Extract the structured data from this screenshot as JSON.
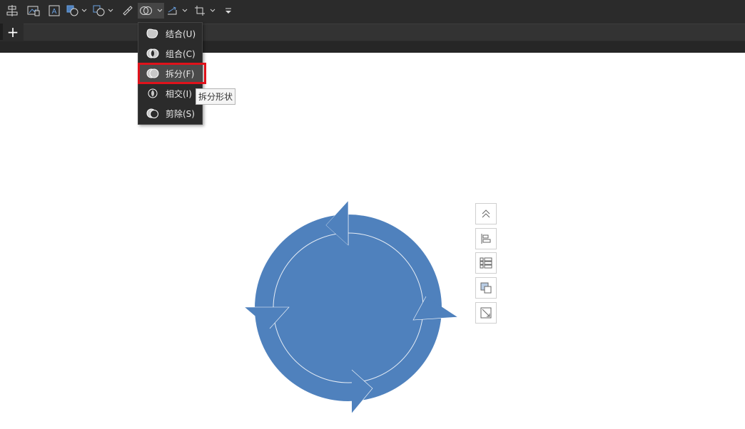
{
  "toolbar": {
    "buttons": [
      {
        "id": "align-center-icon"
      },
      {
        "id": "picture-icon"
      },
      {
        "id": "textbox-icon"
      },
      {
        "id": "shape-fill-icon"
      },
      {
        "id": "shape-outline-icon"
      },
      {
        "id": "format-painter-icon"
      },
      {
        "id": "merge-shapes-icon"
      },
      {
        "id": "rotate-icon"
      },
      {
        "id": "crop-icon"
      },
      {
        "id": "more-icon"
      }
    ]
  },
  "tabs": {
    "add_label": "+"
  },
  "merge_menu": {
    "items": [
      {
        "label": "结合(U)",
        "icon": "union-icon"
      },
      {
        "label": "组合(C)",
        "icon": "combine-icon"
      },
      {
        "label": "拆分(F)",
        "icon": "fragment-icon",
        "selected": true
      },
      {
        "label": "相交(I)",
        "icon": "intersect-icon"
      },
      {
        "label": "剪除(S)",
        "icon": "subtract-icon"
      }
    ],
    "tooltip": "拆分形状"
  },
  "side_panel": {
    "buttons": [
      "collapse-icon",
      "align-icon",
      "layout-icon",
      "fill-icon",
      "resize-icon"
    ]
  },
  "colors": {
    "shape_blue": "#4f81bd",
    "highlight_red": "#e0121b",
    "toolbar_bg": "#2b2b2b"
  }
}
